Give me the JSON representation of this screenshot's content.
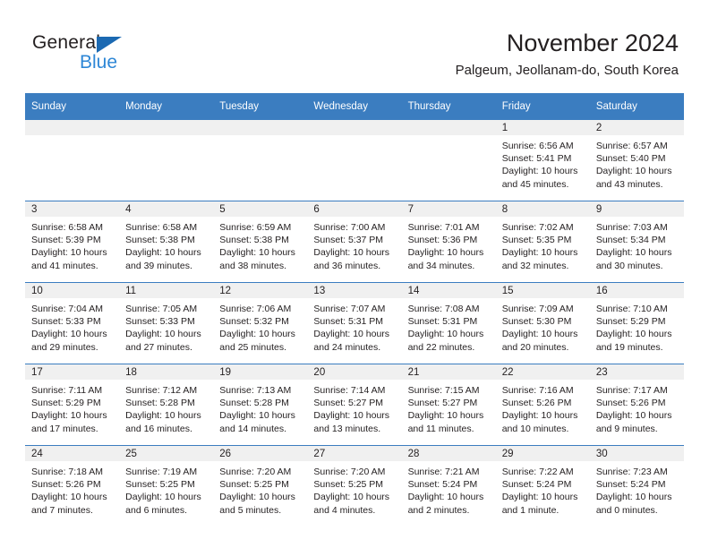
{
  "brand": {
    "name_part1": "General",
    "name_part2": "Blue",
    "accent_color": "#2e87d6",
    "triangle_color": "#1b69b2"
  },
  "header": {
    "title": "November 2024",
    "subtitle": "Palgeum, Jeollanam-do, South Korea",
    "header_bg_color": "#3b7dc0"
  },
  "weekday_headers": [
    "Sunday",
    "Monday",
    "Tuesday",
    "Wednesday",
    "Thursday",
    "Friday",
    "Saturday"
  ],
  "weeks": [
    [
      {
        "day": "",
        "sunrise": "",
        "sunset": "",
        "daylight1": "",
        "daylight2": ""
      },
      {
        "day": "",
        "sunrise": "",
        "sunset": "",
        "daylight1": "",
        "daylight2": ""
      },
      {
        "day": "",
        "sunrise": "",
        "sunset": "",
        "daylight1": "",
        "daylight2": ""
      },
      {
        "day": "",
        "sunrise": "",
        "sunset": "",
        "daylight1": "",
        "daylight2": ""
      },
      {
        "day": "",
        "sunrise": "",
        "sunset": "",
        "daylight1": "",
        "daylight2": ""
      },
      {
        "day": "1",
        "sunrise": "Sunrise: 6:56 AM",
        "sunset": "Sunset: 5:41 PM",
        "daylight1": "Daylight: 10 hours",
        "daylight2": "and 45 minutes."
      },
      {
        "day": "2",
        "sunrise": "Sunrise: 6:57 AM",
        "sunset": "Sunset: 5:40 PM",
        "daylight1": "Daylight: 10 hours",
        "daylight2": "and 43 minutes."
      }
    ],
    [
      {
        "day": "3",
        "sunrise": "Sunrise: 6:58 AM",
        "sunset": "Sunset: 5:39 PM",
        "daylight1": "Daylight: 10 hours",
        "daylight2": "and 41 minutes."
      },
      {
        "day": "4",
        "sunrise": "Sunrise: 6:58 AM",
        "sunset": "Sunset: 5:38 PM",
        "daylight1": "Daylight: 10 hours",
        "daylight2": "and 39 minutes."
      },
      {
        "day": "5",
        "sunrise": "Sunrise: 6:59 AM",
        "sunset": "Sunset: 5:38 PM",
        "daylight1": "Daylight: 10 hours",
        "daylight2": "and 38 minutes."
      },
      {
        "day": "6",
        "sunrise": "Sunrise: 7:00 AM",
        "sunset": "Sunset: 5:37 PM",
        "daylight1": "Daylight: 10 hours",
        "daylight2": "and 36 minutes."
      },
      {
        "day": "7",
        "sunrise": "Sunrise: 7:01 AM",
        "sunset": "Sunset: 5:36 PM",
        "daylight1": "Daylight: 10 hours",
        "daylight2": "and 34 minutes."
      },
      {
        "day": "8",
        "sunrise": "Sunrise: 7:02 AM",
        "sunset": "Sunset: 5:35 PM",
        "daylight1": "Daylight: 10 hours",
        "daylight2": "and 32 minutes."
      },
      {
        "day": "9",
        "sunrise": "Sunrise: 7:03 AM",
        "sunset": "Sunset: 5:34 PM",
        "daylight1": "Daylight: 10 hours",
        "daylight2": "and 30 minutes."
      }
    ],
    [
      {
        "day": "10",
        "sunrise": "Sunrise: 7:04 AM",
        "sunset": "Sunset: 5:33 PM",
        "daylight1": "Daylight: 10 hours",
        "daylight2": "and 29 minutes."
      },
      {
        "day": "11",
        "sunrise": "Sunrise: 7:05 AM",
        "sunset": "Sunset: 5:33 PM",
        "daylight1": "Daylight: 10 hours",
        "daylight2": "and 27 minutes."
      },
      {
        "day": "12",
        "sunrise": "Sunrise: 7:06 AM",
        "sunset": "Sunset: 5:32 PM",
        "daylight1": "Daylight: 10 hours",
        "daylight2": "and 25 minutes."
      },
      {
        "day": "13",
        "sunrise": "Sunrise: 7:07 AM",
        "sunset": "Sunset: 5:31 PM",
        "daylight1": "Daylight: 10 hours",
        "daylight2": "and 24 minutes."
      },
      {
        "day": "14",
        "sunrise": "Sunrise: 7:08 AM",
        "sunset": "Sunset: 5:31 PM",
        "daylight1": "Daylight: 10 hours",
        "daylight2": "and 22 minutes."
      },
      {
        "day": "15",
        "sunrise": "Sunrise: 7:09 AM",
        "sunset": "Sunset: 5:30 PM",
        "daylight1": "Daylight: 10 hours",
        "daylight2": "and 20 minutes."
      },
      {
        "day": "16",
        "sunrise": "Sunrise: 7:10 AM",
        "sunset": "Sunset: 5:29 PM",
        "daylight1": "Daylight: 10 hours",
        "daylight2": "and 19 minutes."
      }
    ],
    [
      {
        "day": "17",
        "sunrise": "Sunrise: 7:11 AM",
        "sunset": "Sunset: 5:29 PM",
        "daylight1": "Daylight: 10 hours",
        "daylight2": "and 17 minutes."
      },
      {
        "day": "18",
        "sunrise": "Sunrise: 7:12 AM",
        "sunset": "Sunset: 5:28 PM",
        "daylight1": "Daylight: 10 hours",
        "daylight2": "and 16 minutes."
      },
      {
        "day": "19",
        "sunrise": "Sunrise: 7:13 AM",
        "sunset": "Sunset: 5:28 PM",
        "daylight1": "Daylight: 10 hours",
        "daylight2": "and 14 minutes."
      },
      {
        "day": "20",
        "sunrise": "Sunrise: 7:14 AM",
        "sunset": "Sunset: 5:27 PM",
        "daylight1": "Daylight: 10 hours",
        "daylight2": "and 13 minutes."
      },
      {
        "day": "21",
        "sunrise": "Sunrise: 7:15 AM",
        "sunset": "Sunset: 5:27 PM",
        "daylight1": "Daylight: 10 hours",
        "daylight2": "and 11 minutes."
      },
      {
        "day": "22",
        "sunrise": "Sunrise: 7:16 AM",
        "sunset": "Sunset: 5:26 PM",
        "daylight1": "Daylight: 10 hours",
        "daylight2": "and 10 minutes."
      },
      {
        "day": "23",
        "sunrise": "Sunrise: 7:17 AM",
        "sunset": "Sunset: 5:26 PM",
        "daylight1": "Daylight: 10 hours",
        "daylight2": "and 9 minutes."
      }
    ],
    [
      {
        "day": "24",
        "sunrise": "Sunrise: 7:18 AM",
        "sunset": "Sunset: 5:26 PM",
        "daylight1": "Daylight: 10 hours",
        "daylight2": "and 7 minutes."
      },
      {
        "day": "25",
        "sunrise": "Sunrise: 7:19 AM",
        "sunset": "Sunset: 5:25 PM",
        "daylight1": "Daylight: 10 hours",
        "daylight2": "and 6 minutes."
      },
      {
        "day": "26",
        "sunrise": "Sunrise: 7:20 AM",
        "sunset": "Sunset: 5:25 PM",
        "daylight1": "Daylight: 10 hours",
        "daylight2": "and 5 minutes."
      },
      {
        "day": "27",
        "sunrise": "Sunrise: 7:20 AM",
        "sunset": "Sunset: 5:25 PM",
        "daylight1": "Daylight: 10 hours",
        "daylight2": "and 4 minutes."
      },
      {
        "day": "28",
        "sunrise": "Sunrise: 7:21 AM",
        "sunset": "Sunset: 5:24 PM",
        "daylight1": "Daylight: 10 hours",
        "daylight2": "and 2 minutes."
      },
      {
        "day": "29",
        "sunrise": "Sunrise: 7:22 AM",
        "sunset": "Sunset: 5:24 PM",
        "daylight1": "Daylight: 10 hours",
        "daylight2": "and 1 minute."
      },
      {
        "day": "30",
        "sunrise": "Sunrise: 7:23 AM",
        "sunset": "Sunset: 5:24 PM",
        "daylight1": "Daylight: 10 hours",
        "daylight2": "and 0 minutes."
      }
    ]
  ]
}
